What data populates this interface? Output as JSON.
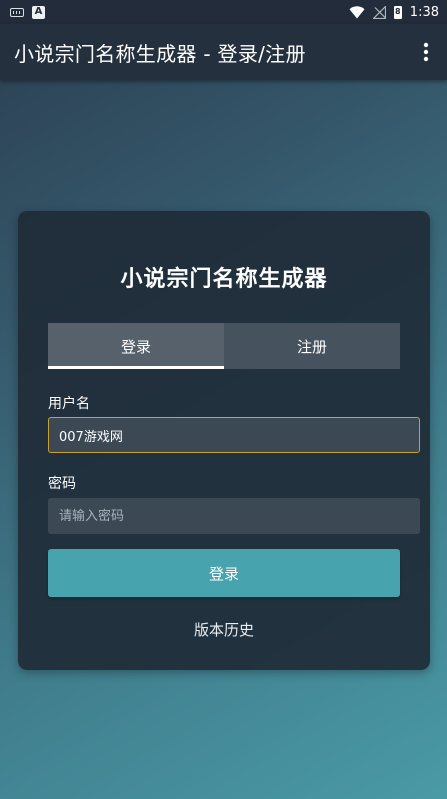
{
  "status_bar": {
    "time": "1:38",
    "battery_label": "8",
    "left_badge": "A",
    "icons": [
      "keyboard-icon",
      "a-badge-icon",
      "wifi-icon",
      "signal-off-icon",
      "battery-icon"
    ]
  },
  "app_bar": {
    "title": "小说宗门名称生成器 - 登录/注册",
    "menu_icon": "more-vert-icon"
  },
  "card": {
    "title": "小说宗门名称生成器",
    "tabs": [
      {
        "label": "登录",
        "active": true
      },
      {
        "label": "注册",
        "active": false
      }
    ],
    "username": {
      "label": "用户名",
      "value": "007游戏网"
    },
    "password": {
      "label": "密码",
      "value": "",
      "placeholder": "请输入密码"
    },
    "submit_label": "登录",
    "history_link": "版本历史"
  },
  "colors": {
    "status_bar": "#222c3a",
    "app_bar": "#25303f",
    "card": "#1f2c38",
    "accent_button": "#47a3ad",
    "focus_border": "#c9a230"
  }
}
